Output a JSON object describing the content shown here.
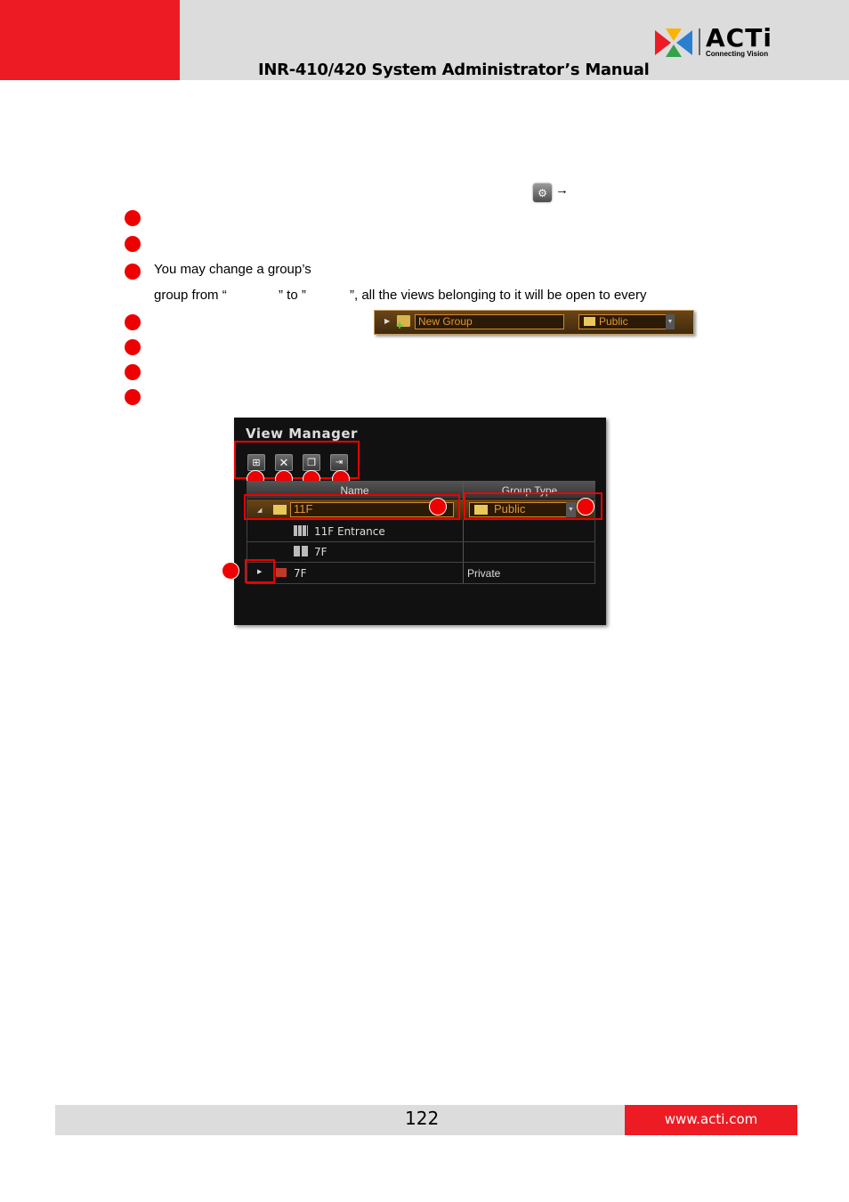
{
  "header": {
    "title": "INR-410/420 System Administrator’s Manual",
    "logo_word": "ACTi",
    "logo_tagline": "Connecting Vision"
  },
  "body": {
    "line3_a": "You  may  change  a  group’s",
    "line3_b_1": "group from “",
    "line3_b_2": "” to ”",
    "line3_b_3": "”, all the views belonging to it will be open to every",
    "arrow": "→"
  },
  "new_group_strip": {
    "name_value": "New Group",
    "type_value": "Public"
  },
  "view_manager": {
    "title": "View Manager",
    "columns": [
      "Name",
      "Group Type"
    ],
    "rows": [
      {
        "name": "11F",
        "type": "Public"
      },
      {
        "name": "11F Entrance",
        "type": ""
      },
      {
        "name": "7F",
        "type": ""
      },
      {
        "name": "7F",
        "type": "Private"
      }
    ]
  },
  "footer": {
    "page_number": "122",
    "url": "www.acti.com"
  },
  "colors": {
    "brand_red": "#ed1c24",
    "header_gray": "#dcdcdc"
  }
}
